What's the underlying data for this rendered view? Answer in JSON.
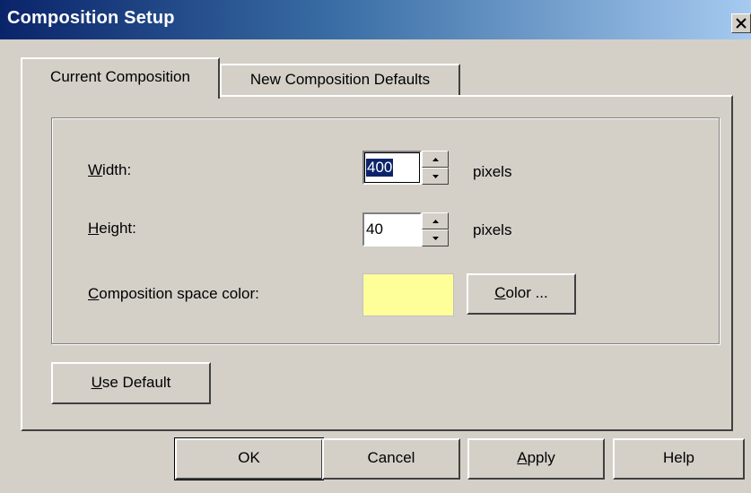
{
  "window": {
    "title": "Composition Setup"
  },
  "tabs": [
    {
      "label": "Current Composition",
      "active": true
    },
    {
      "label": "New Composition Defaults",
      "active": false
    }
  ],
  "fields": {
    "width": {
      "label_mnemonic": "W",
      "label_rest": "idth:",
      "value": "400",
      "unit": "pixels"
    },
    "height": {
      "label_mnemonic": "H",
      "label_rest": "eight:",
      "value": "40",
      "unit": "pixels"
    },
    "space_color": {
      "label_mnemonic": "C",
      "label_rest": "omposition space color:",
      "color": "#ffff99"
    }
  },
  "buttons": {
    "color": {
      "mnemonic": "C",
      "rest": "olor ..."
    },
    "use_default": {
      "mnemonic": "U",
      "rest": "se Default"
    },
    "ok": "OK",
    "cancel": "Cancel",
    "apply": {
      "mnemonic": "A",
      "rest": "pply"
    },
    "help": "Help"
  },
  "icons": {
    "close": "close-x-icon",
    "spin_up": "triangle-up-icon",
    "spin_down": "triangle-down-icon"
  },
  "colors": {
    "face": "#d4d0c8",
    "title_start": "#0a246a",
    "title_end": "#a6caf0",
    "selection": "#0a246a"
  }
}
